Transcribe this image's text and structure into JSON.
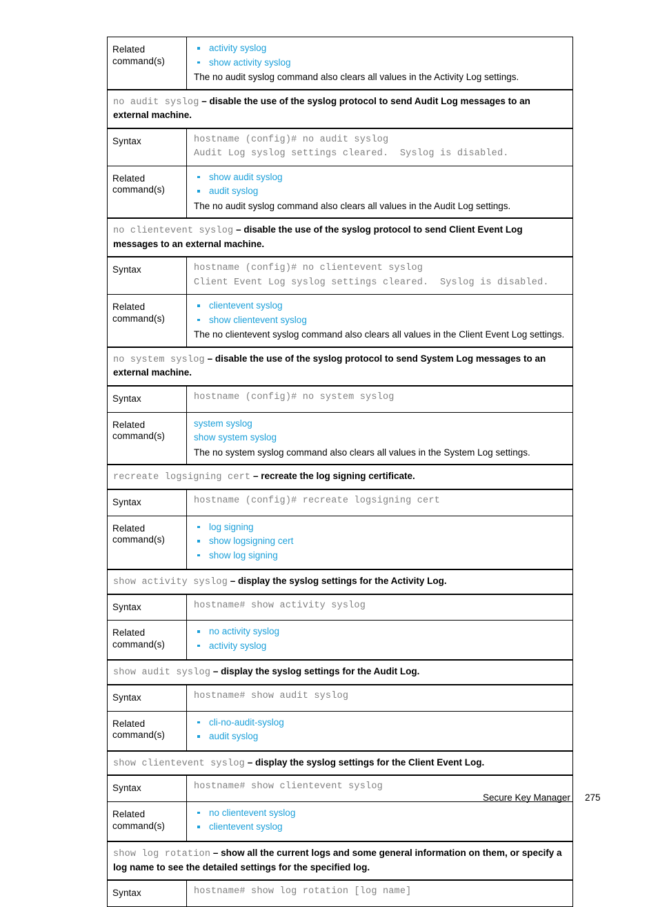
{
  "document": {
    "footer_title": "Secure Key Manager",
    "page_number": "275",
    "link_color": "#1a9fd9",
    "code_color": "#808080"
  },
  "labels": {
    "related": "Related",
    "related_2": "command(s)",
    "syntax": "Syntax"
  },
  "rows": {
    "r1_related": {
      "links": [
        "activity syslog",
        "show activity syslog"
      ],
      "note": "The no audit syslog command also clears all values in the Activity Log settings."
    },
    "r2_section": {
      "command": "no audit syslog",
      "desc": " – disable the use of the syslog protocol to send Audit Log messages to an external machine."
    },
    "r3_syntax": {
      "line1": "hostname (config)# no audit syslog",
      "line2": "Audit Log syslog settings cleared.  Syslog is disabled."
    },
    "r4_related": {
      "links": [
        "show audit syslog",
        "audit syslog"
      ],
      "note": "The no audit syslog command also clears all values in the Audit Log settings."
    },
    "r5_section": {
      "command": "no clientevent syslog",
      "desc": " – disable the use of the syslog protocol to send Client Event Log messages to an external machine."
    },
    "r6_syntax": {
      "line1": "hostname (config)# no clientevent syslog",
      "line2": "Client Event Log syslog settings cleared.  Syslog is disabled."
    },
    "r7_related": {
      "links": [
        "clientevent syslog",
        "show clientevent syslog"
      ],
      "note": "The no clientevent syslog command also clears all values in the Client Event Log settings."
    },
    "r8_section": {
      "command": "no system syslog",
      "desc": " – disable the use of the syslog protocol to send System Log messages to an external machine."
    },
    "r9_syntax": {
      "line1": "hostname (config)# no system syslog"
    },
    "r10_related": {
      "links": [
        "system syslog",
        "show system syslog"
      ],
      "note": "The no system syslog command also clears all values in the System Log settings."
    },
    "r11_section": {
      "command": "recreate logsigning cert",
      "desc": " – recreate the log signing certificate."
    },
    "r12_syntax": {
      "line1": "hostname (config)# recreate logsigning cert"
    },
    "r13_related": {
      "links": [
        "log signing",
        "show logsigning cert",
        "show log signing"
      ]
    },
    "r14_section": {
      "command": "show activity syslog",
      "desc": " – display the syslog settings for the Activity Log."
    },
    "r15_syntax": {
      "line1": "hostname# show activity syslog"
    },
    "r16_related": {
      "links": [
        "no activity syslog",
        "activity syslog"
      ]
    },
    "r17_section": {
      "command": "show audit syslog",
      "desc": " – display the syslog settings for the Audit Log."
    },
    "r18_syntax": {
      "line1": "hostname# show audit syslog"
    },
    "r19_related": {
      "links": [
        "cli-no-audit-syslog",
        "audit syslog"
      ]
    },
    "r20_section": {
      "command": "show clientevent syslog",
      "desc": " – display the syslog settings for the Client Event Log."
    },
    "r21_syntax": {
      "line1": "hostname# show clientevent syslog"
    },
    "r22_related": {
      "links": [
        "no clientevent syslog",
        "clientevent syslog"
      ]
    },
    "r23_section": {
      "command": "show log rotation",
      "desc": " – show all the current logs and some general information on them, or specify a log name to see the detailed settings for the specified log."
    },
    "r24_syntax": {
      "line1": "hostname# show log rotation [log name]"
    }
  }
}
